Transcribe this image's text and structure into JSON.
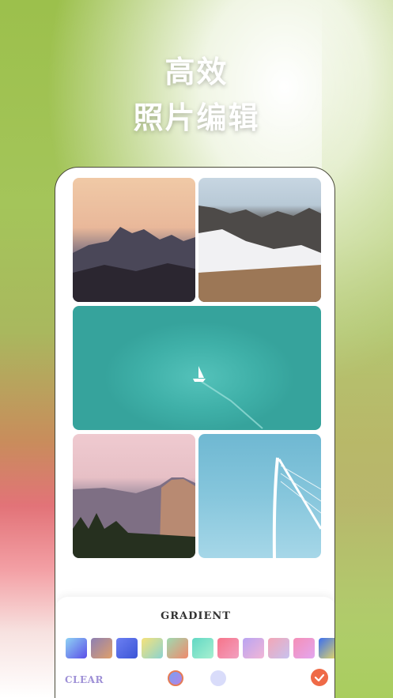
{
  "headline": {
    "line1": "高效",
    "line2": "照片编辑"
  },
  "gallery": {
    "photos": [
      {
        "subject": "mountain-sunset"
      },
      {
        "subject": "snowy-ridge"
      },
      {
        "subject": "sailboat-on-sea"
      },
      {
        "subject": "half-dome-dusk"
      },
      {
        "subject": "cable-bridge-sky"
      }
    ]
  },
  "panel": {
    "title": "GRADIENT",
    "clear_label": "CLEAR",
    "confirm_icon": "check-icon",
    "swatches": [
      {
        "from": "#8fd3f4",
        "to": "#5a4ee8"
      },
      {
        "from": "#8d7fb3",
        "to": "#e0a06a"
      },
      {
        "from": "#6b7ff2",
        "to": "#3c55d6"
      },
      {
        "from": "#f6e27a",
        "to": "#8bd3d0"
      },
      {
        "from": "#9fd9b0",
        "to": "#f08a6c"
      },
      {
        "from": "#62d8c4",
        "to": "#a7f0d0"
      },
      {
        "from": "#f6748a",
        "to": "#f2a0c0"
      },
      {
        "from": "#b9a4f2",
        "to": "#f2b6d6"
      },
      {
        "from": "#f3a6b6",
        "to": "#c7c2ef"
      },
      {
        "from": "#f58fb6",
        "to": "#e3a6f0"
      },
      {
        "from": "#3b6ff0",
        "to": "#f3e05a"
      }
    ],
    "selected_color": "#e57b55"
  }
}
